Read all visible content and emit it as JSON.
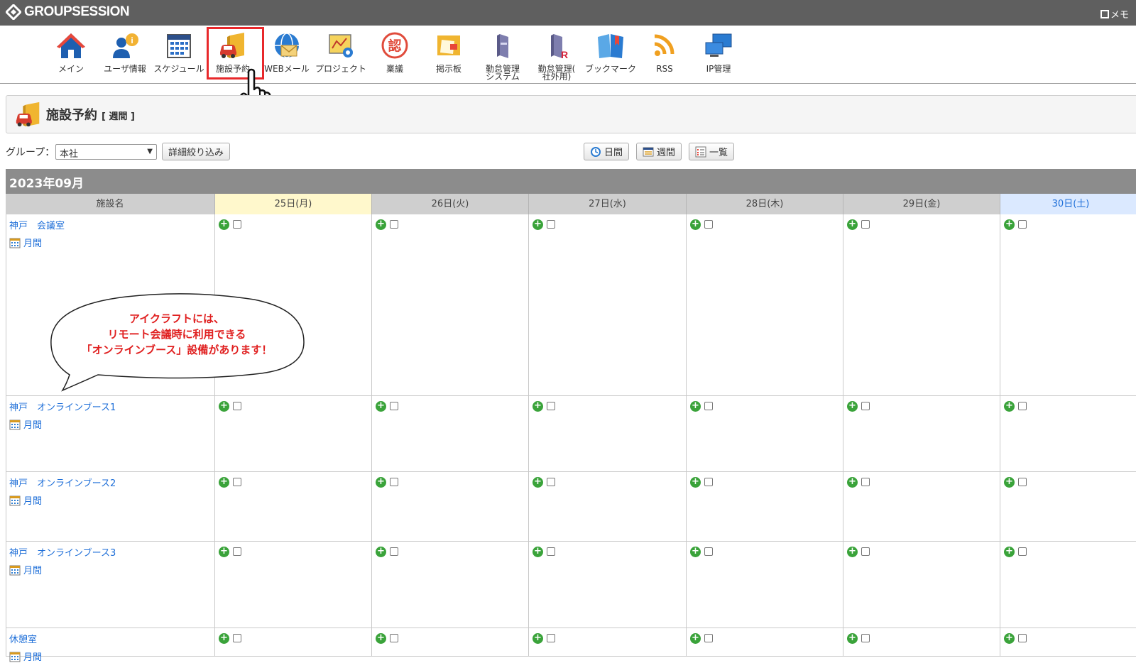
{
  "app": {
    "name": "GROUPSESSION",
    "memo_label": "メモ"
  },
  "apps": [
    {
      "label": "メイン",
      "icon": "home-icon"
    },
    {
      "label": "ユーザ情報",
      "icon": "user-info-icon"
    },
    {
      "label": "スケジュール",
      "icon": "schedule-icon"
    },
    {
      "label": "施設予約",
      "icon": "facility-reservation-icon",
      "selected": true
    },
    {
      "label": "WEBメール",
      "icon": "webmail-icon"
    },
    {
      "label": "プロジェクト",
      "icon": "project-icon"
    },
    {
      "label": "稟議",
      "icon": "approval-icon"
    },
    {
      "label": "掲示板",
      "icon": "bulletin-board-icon"
    },
    {
      "label": "勤怠管理",
      "sub": "システム",
      "icon": "attendance-icon"
    },
    {
      "label": "勤怠管理(",
      "sub": "社外用)",
      "icon": "attendance-external-icon"
    },
    {
      "label": "ブックマーク",
      "icon": "bookmark-icon"
    },
    {
      "label": "RSS",
      "icon": "rss-icon"
    },
    {
      "label": "IP管理",
      "icon": "ip-management-icon"
    }
  ],
  "page": {
    "title": "施設予約",
    "view": "[ 週間 ]"
  },
  "filter": {
    "group_label": "グループ：",
    "group_value": "本社",
    "detail_button": "詳細絞り込み",
    "view_buttons": {
      "day": "日間",
      "week": "週間",
      "list": "一覧"
    }
  },
  "calendar": {
    "month": "2023年09月",
    "facility_header": "施設名",
    "days": [
      {
        "label": "25日(月)",
        "type": "today"
      },
      {
        "label": "26日(火)",
        "type": "weekday"
      },
      {
        "label": "27日(水)",
        "type": "weekday"
      },
      {
        "label": "28日(木)",
        "type": "weekday"
      },
      {
        "label": "29日(金)",
        "type": "weekday"
      },
      {
        "label": "30日(土)",
        "type": "saturday"
      }
    ],
    "monthly_link": "月間",
    "facilities": [
      {
        "name": "神戸　会議室"
      },
      {
        "name": "神戸　オンラインブース1"
      },
      {
        "name": "神戸　オンラインブース2"
      },
      {
        "name": "神戸　オンラインブース3"
      },
      {
        "name": "休憩室"
      }
    ]
  },
  "callout": {
    "line1": "アイクラフトには、",
    "line2": "リモート会議時に利用できる",
    "line3": "「オンラインブース」設備があります！"
  },
  "colors": {
    "selection_box": "#e8282b",
    "link": "#1d6ed8",
    "callout_text": "#e02020",
    "today": "#fff8cc",
    "saturday": "#dbe9ff"
  }
}
